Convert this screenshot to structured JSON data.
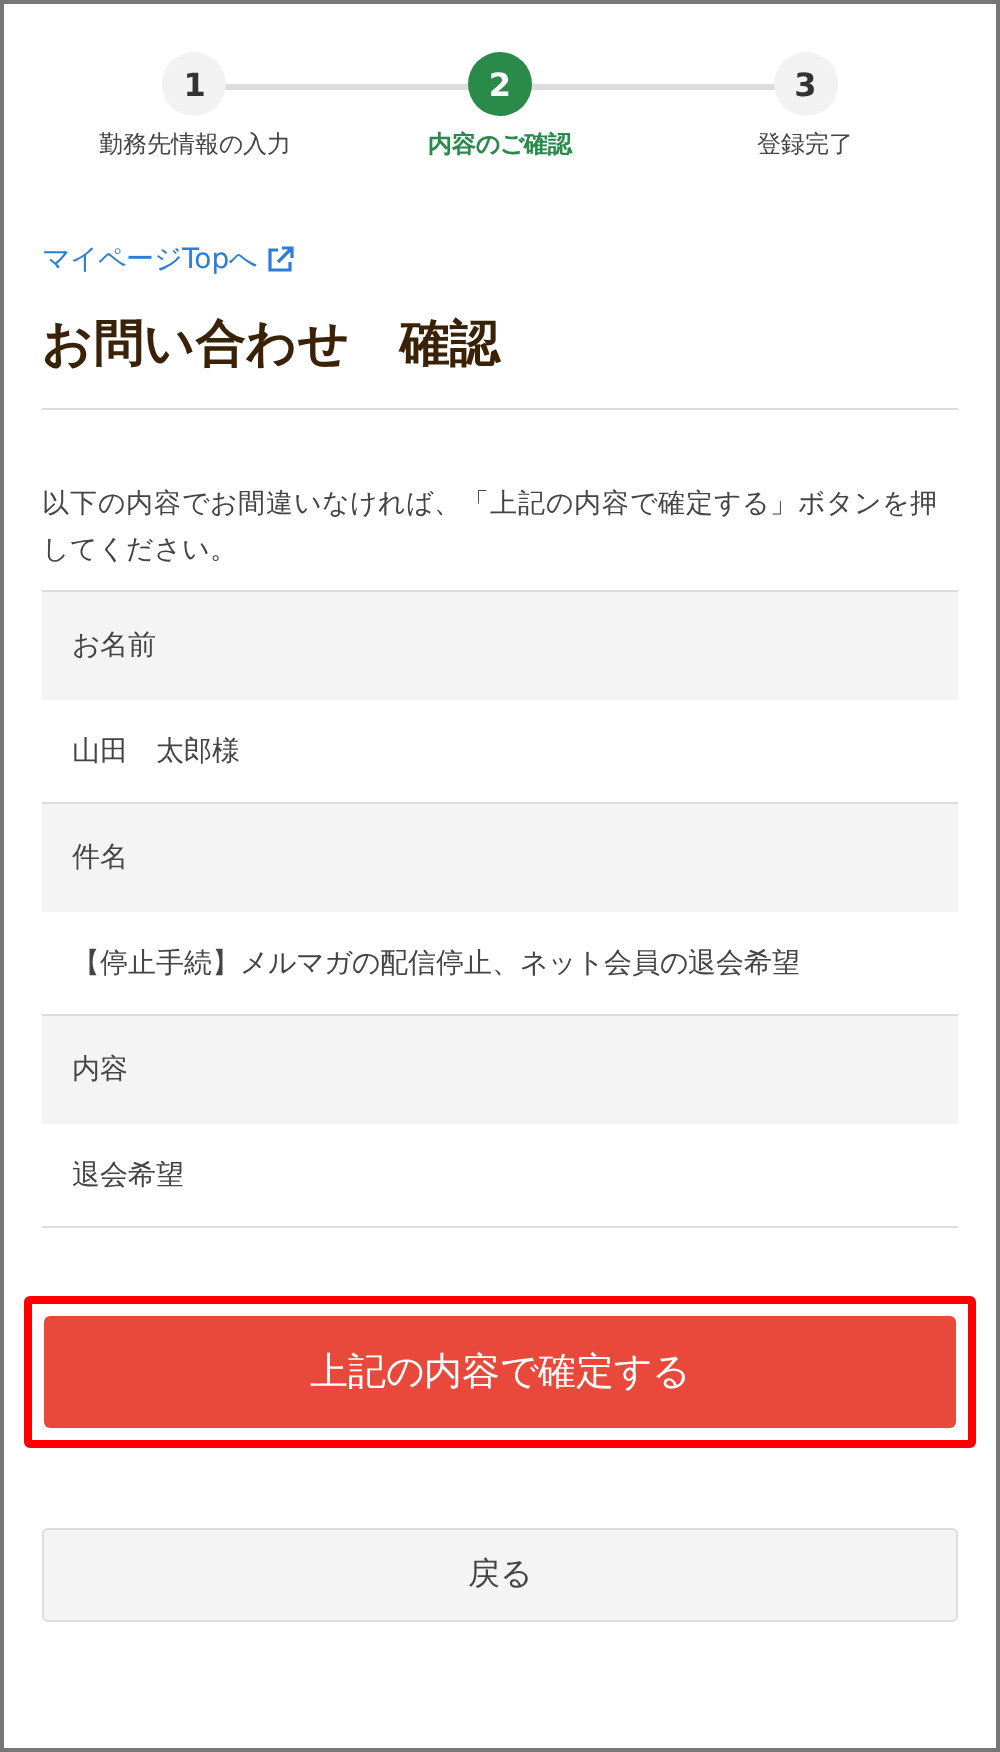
{
  "steps": [
    {
      "number": "1",
      "label": "勤務先情報の入力",
      "selected": false
    },
    {
      "number": "2",
      "label": "内容のご確認",
      "selected": true
    },
    {
      "number": "3",
      "label": "登録完了",
      "selected": false
    }
  ],
  "link": {
    "text": "マイページTopへ"
  },
  "title": "お問い合わせ　確認",
  "intro": "以下の内容でお間違いなければ、「上記の内容で確定する」ボタンを押してください。",
  "fields": [
    {
      "label": "お名前",
      "value": "山田　太郎様"
    },
    {
      "label": "件名",
      "value": "【停止手続】メルマガの配信停止、ネット会員の退会希望"
    },
    {
      "label": "内容",
      "value": "退会希望"
    }
  ],
  "confirm_button": {
    "label": "上記の内容で確定する",
    "highlighted": true
  },
  "back_button": {
    "label": "戻る"
  }
}
